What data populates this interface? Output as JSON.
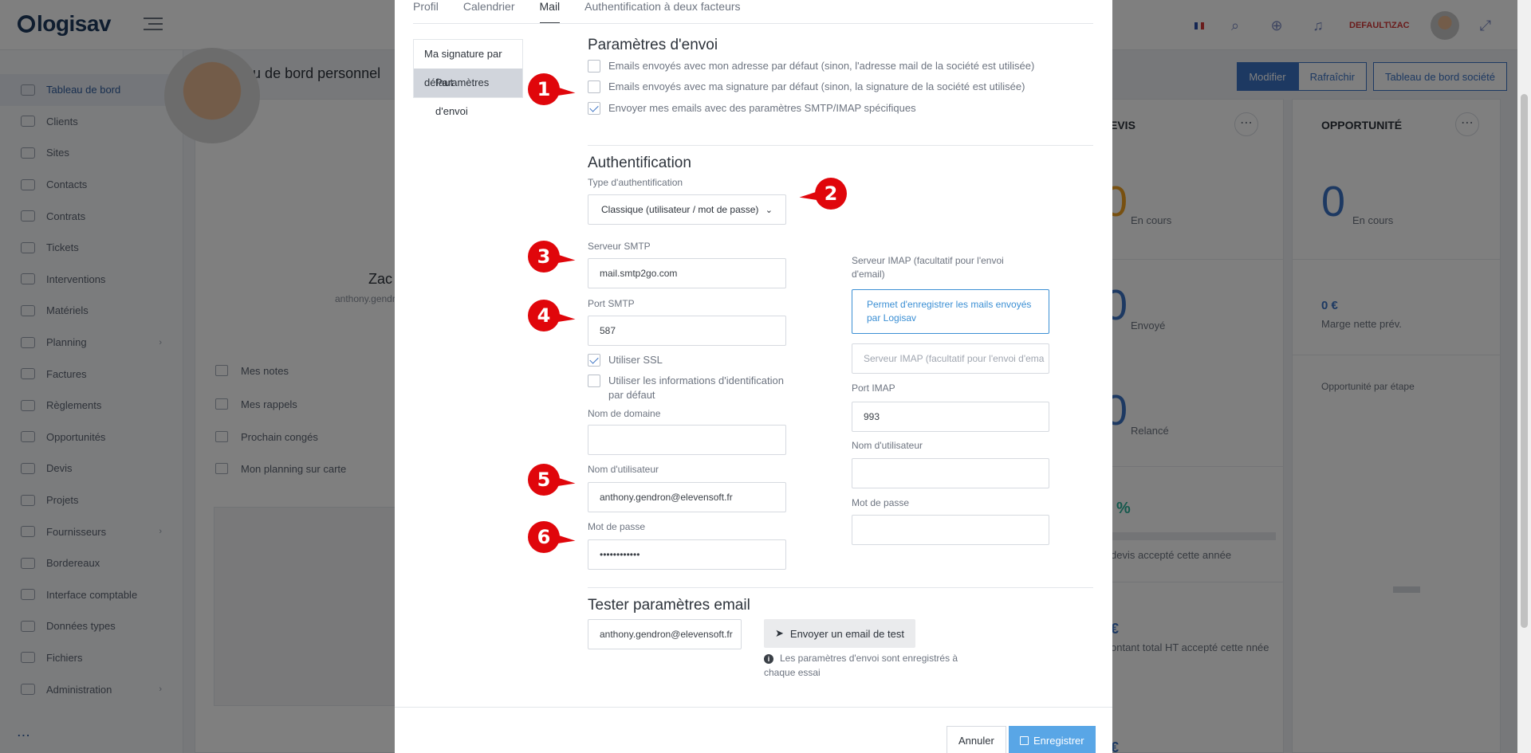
{
  "app": {
    "logo": "logisav",
    "user_label": "DEFAULT\\ZAC",
    "page_title": "Tableau de bord personnel",
    "buttons": {
      "modify": "Modifier",
      "refresh": "Rafraîchir",
      "company_dashboard": "Tableau de bord société"
    },
    "sidebar": [
      {
        "label": "Tableau de bord",
        "active": true
      },
      {
        "label": "Clients"
      },
      {
        "label": "Sites"
      },
      {
        "label": "Contacts"
      },
      {
        "label": "Contrats"
      },
      {
        "label": "Tickets"
      },
      {
        "label": "Interventions"
      },
      {
        "label": "Matériels"
      },
      {
        "label": "Planning",
        "chevron": true
      },
      {
        "label": "Factures"
      },
      {
        "label": "Règlements"
      },
      {
        "label": "Opportunités"
      },
      {
        "label": "Devis"
      },
      {
        "label": "Projets"
      },
      {
        "label": "Fournisseurs",
        "chevron": true
      },
      {
        "label": "Bordereaux"
      },
      {
        "label": "Interface comptable"
      },
      {
        "label": "Données types"
      },
      {
        "label": "Fichiers"
      },
      {
        "label": "Administration",
        "chevron": true
      }
    ],
    "sidebar_more": "...",
    "profile": {
      "name": "Zac",
      "email": "anthony.gendr",
      "links": [
        "Mes notes",
        "Mes rappels",
        "Prochain congés",
        "Mon planning sur carte"
      ]
    },
    "devis": {
      "title": "EVIS",
      "kpis": [
        {
          "value": "0",
          "label": "En cours"
        },
        {
          "value": "0",
          "label": "Envoyé"
        },
        {
          "value": "0",
          "label": "Relancé"
        }
      ],
      "percent": "%",
      "percent_label": "devis accepté cette année",
      "amount_symbol": "€",
      "amount_label": "ontant total HT accepté cette nnée",
      "more_symbol": "€"
    },
    "opportunite": {
      "title": "OPPORTUNITÉ",
      "count": "0",
      "count_label": "En cours",
      "marge": "0 €",
      "marge_label": "Marge nette prév.",
      "stage_label": "Opportunité par étape"
    }
  },
  "modal": {
    "tabs": [
      {
        "label": "Profil"
      },
      {
        "label": "Calendrier"
      },
      {
        "label": "Mail",
        "active": true
      },
      {
        "label": "Authentification à deux facteurs"
      }
    ],
    "subnav": [
      {
        "label": "Ma signature par défaut"
      },
      {
        "label": "Paramètres d'envoi",
        "active": true
      }
    ],
    "envoi": {
      "title": "Paramètres d'envoi",
      "options": [
        {
          "label": "Emails envoyés avec mon adresse par défaut (sinon, l'adresse mail de la société est utilisée)",
          "checked": false
        },
        {
          "label": "Emails envoyés avec ma signature par défaut (sinon, la signature de la société est utilisée)",
          "checked": false
        },
        {
          "label": "Envoyer mes emails avec des paramètres SMTP/IMAP spécifiques",
          "checked": true
        }
      ]
    },
    "auth": {
      "title": "Authentification",
      "type_label": "Type d'authentification",
      "type_value": "Classique (utilisateur / mot de passe)",
      "smtp_server_label": "Serveur SMTP",
      "smtp_server": "mail.smtp2go.com",
      "smtp_port_label": "Port SMTP",
      "smtp_port": "587",
      "use_ssl_label": "Utiliser SSL",
      "use_ssl": true,
      "default_credentials_label": "Utiliser les informations d'identification par défaut",
      "default_credentials": false,
      "domain_label": "Nom de domaine",
      "domain": "",
      "username_label": "Nom d'utilisateur",
      "username": "anthony.gendron@elevensoft.fr",
      "password_label": "Mot de passe",
      "password": "••••••••••••",
      "imap_server_label": "Serveur IMAP (facultatif pour l'envoi d'email)",
      "imap_info": "Permet d'enregistrer les mails envoyés par Logisav",
      "imap_server_placeholder": "Serveur IMAP (facultatif pour l'envoi d'ema",
      "imap_port_label": "Port IMAP",
      "imap_port": "993",
      "imap_username_label": "Nom d'utilisateur",
      "imap_password_label": "Mot de passe"
    },
    "test": {
      "title": "Tester paramètres email",
      "email": "anthony.gendron@elevensoft.fr",
      "send_button": "Envoyer un email de test",
      "note": "Les paramètres d'envoi sont enregistrés à chaque essai"
    },
    "footer": {
      "cancel": "Annuler",
      "save": "Enregistrer"
    }
  },
  "markers": [
    "1",
    "2",
    "3",
    "4",
    "5",
    "6"
  ],
  "colors": {
    "accent": "#3b73c4",
    "marker": "#e0060b",
    "save": "#59a6e6"
  }
}
